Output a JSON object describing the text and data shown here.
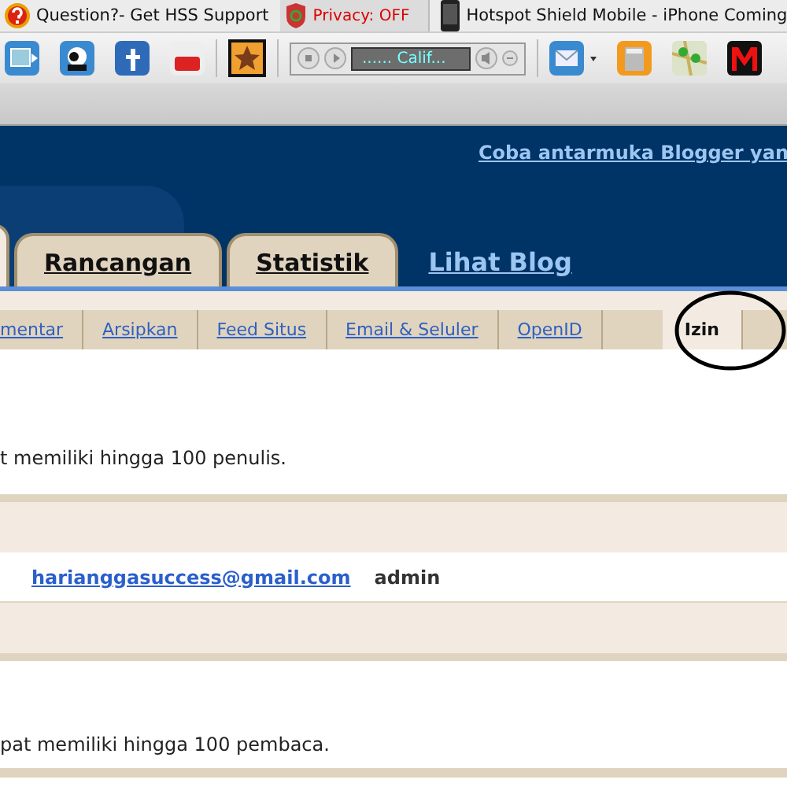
{
  "bookmarks": [
    {
      "kind": "help",
      "label": "Question?- Get HSS Support"
    },
    {
      "kind": "shield",
      "label": "Privacy: OFF"
    },
    {
      "kind": "phone",
      "label": "Hotspot Shield Mobile - iPhone Coming"
    }
  ],
  "player": {
    "station": "...... Calif..."
  },
  "header_link": "Coba antarmuka Blogger yan",
  "tabs": [
    {
      "selected": true
    },
    {
      "label": "Rancangan",
      "selected": false
    },
    {
      "label": "Statistik",
      "selected": false
    }
  ],
  "view_blog_link": "Lihat Blog",
  "subtabs": [
    {
      "label": "mentar",
      "selected": false
    },
    {
      "label": "Arsipkan",
      "selected": false
    },
    {
      "label": "Feed Situs",
      "selected": false
    },
    {
      "label": "Email & Seluler",
      "selected": false
    },
    {
      "label": "OpenID",
      "selected": false
    },
    {
      "label": "Izin",
      "selected": true
    }
  ],
  "authors_note": "t memiliki hingga 100 penulis.",
  "authors": [
    {
      "email": "harianggasuccess@gmail.com",
      "role": "admin"
    }
  ],
  "readers_note": "pat memiliki hingga 100 pembaca."
}
